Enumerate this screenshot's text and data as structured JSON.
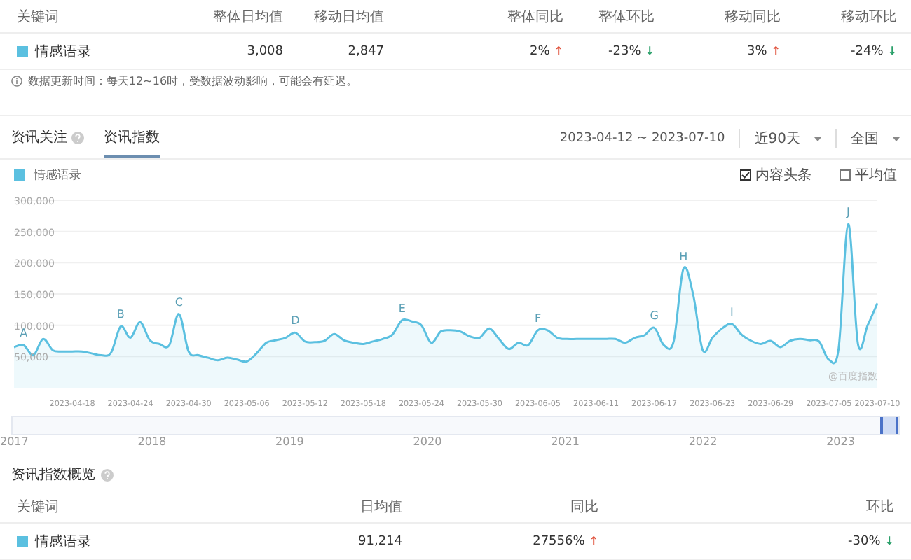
{
  "summary_table": {
    "columns": [
      "关键词",
      "整体日均值",
      "移动日均值",
      "整体同比",
      "整体环比",
      "移动同比",
      "移动环比"
    ],
    "rows": [
      {
        "color": "#5bc0e0",
        "cells": [
          {
            "value": "情感语录"
          },
          {
            "value": "3,008"
          },
          {
            "value": "2,847"
          },
          {
            "value": "2%",
            "arrow": "↑",
            "color": "#e0503a"
          },
          {
            "value": "-23%",
            "arrow": "↓",
            "color": "#2aa06a"
          },
          {
            "value": "3%",
            "arrow": "↑",
            "color": "#e0503a"
          },
          {
            "value": "-24%",
            "arrow": "↓",
            "color": "#2aa06a"
          }
        ]
      }
    ]
  },
  "note": "数据更新时间：每天12~16时，受数据波动影响，可能会有延迟。",
  "tabs": [
    {
      "label": "资讯关注",
      "selected": false,
      "help": true
    },
    {
      "label": "资讯指数",
      "selected": true,
      "help": false
    }
  ],
  "date_range": "2023-04-12 ~ 2023-07-10",
  "dropdowns": [
    {
      "label": "近90天"
    },
    {
      "label": "全国"
    }
  ],
  "options": [
    {
      "label": "内容头条",
      "checked": true
    },
    {
      "label": "平均值",
      "checked": false
    }
  ],
  "chart_data": {
    "type": "area",
    "grid": true,
    "ylim": [
      0,
      300000
    ],
    "yticks": [
      {
        "value": 50000,
        "label": "50,000"
      },
      {
        "value": 100000,
        "label": "100,000"
      },
      {
        "value": 150000,
        "label": "150,000"
      },
      {
        "value": 200000,
        "label": "200,000"
      },
      {
        "value": 250000,
        "label": "250,000"
      },
      {
        "value": 300000,
        "label": "300,000"
      }
    ],
    "categories": [
      null,
      null,
      null,
      null,
      null,
      null,
      "2023-04-18",
      null,
      null,
      null,
      null,
      null,
      "2023-04-24",
      null,
      null,
      null,
      null,
      null,
      "2023-04-30",
      null,
      null,
      null,
      null,
      null,
      "2023-05-06",
      null,
      null,
      null,
      null,
      null,
      "2023-05-12",
      null,
      null,
      null,
      null,
      null,
      "2023-05-18",
      null,
      null,
      null,
      null,
      null,
      "2023-05-24",
      null,
      null,
      null,
      null,
      null,
      "2023-05-30",
      null,
      null,
      null,
      null,
      null,
      "2023-06-05",
      null,
      null,
      null,
      null,
      null,
      "2023-06-11",
      null,
      null,
      null,
      null,
      null,
      "2023-06-17",
      null,
      null,
      null,
      null,
      null,
      "2023-06-23",
      null,
      null,
      null,
      null,
      null,
      "2023-06-29",
      null,
      null,
      null,
      null,
      null,
      "2023-07-05",
      null,
      null,
      null,
      null,
      "2023-07-10"
    ],
    "annotations": [
      "A",
      "B",
      "C",
      "D",
      "E",
      "F",
      "G",
      "H",
      "I",
      "J"
    ],
    "series": [
      {
        "name": "情感语录",
        "color": "#5bc0e0",
        "values": [
          65000,
          68000,
          52000,
          78000,
          60000,
          58000,
          58000,
          58000,
          55000,
          52000,
          56000,
          98000,
          80000,
          105000,
          76000,
          70000,
          68000,
          118000,
          58000,
          52000,
          48000,
          44000,
          48000,
          45000,
          42000,
          55000,
          72000,
          76000,
          80000,
          88000,
          74000,
          73000,
          75000,
          86000,
          76000,
          72000,
          70000,
          74000,
          78000,
          85000,
          108000,
          106000,
          100000,
          72000,
          90000,
          92000,
          90000,
          82000,
          80000,
          95000,
          78000,
          62000,
          72000,
          68000,
          92000,
          92000,
          80000,
          78000,
          78000,
          78000,
          78000,
          78000,
          78000,
          72000,
          80000,
          84000,
          96000,
          68000,
          74000,
          190000,
          150000,
          60000,
          80000,
          95000,
          102000,
          85000,
          75000,
          70000,
          75000,
          65000,
          75000,
          78000,
          76000,
          74000,
          45000,
          62000,
          262000,
          70000,
          100000,
          135000
        ]
      }
    ]
  },
  "chart_watermark": "@百度指数",
  "timeline": {
    "level": 0.02,
    "years": [
      "2017",
      "2018",
      "2019",
      "2020",
      "2021",
      "2022",
      "2023"
    ]
  },
  "overview": {
    "title": "资讯指数概览",
    "columns": [
      "关键词",
      "日均值",
      "同比",
      "环比"
    ],
    "rows": [
      {
        "color": "#5bc0e0",
        "cells": [
          {
            "value": "情感语录"
          },
          {
            "value": "91,214"
          },
          {
            "value": "27556%",
            "arrow": "↑",
            "color": "#e0503a"
          },
          {
            "value": "-30%",
            "arrow": "↓",
            "color": "#2aa06a"
          }
        ]
      }
    ]
  }
}
